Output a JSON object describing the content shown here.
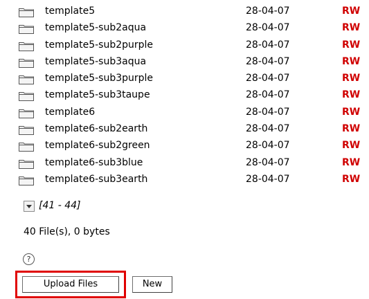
{
  "files": [
    {
      "name": "template5",
      "date": "28-04-07",
      "perm": "RW"
    },
    {
      "name": "template5-sub2aqua",
      "date": "28-04-07",
      "perm": "RW"
    },
    {
      "name": "template5-sub2purple",
      "date": "28-04-07",
      "perm": "RW"
    },
    {
      "name": "template5-sub3aqua",
      "date": "28-04-07",
      "perm": "RW"
    },
    {
      "name": "template5-sub3purple",
      "date": "28-04-07",
      "perm": "RW"
    },
    {
      "name": "template5-sub3taupe",
      "date": "28-04-07",
      "perm": "RW"
    },
    {
      "name": "template6",
      "date": "28-04-07",
      "perm": "RW"
    },
    {
      "name": "template6-sub2earth",
      "date": "28-04-07",
      "perm": "RW"
    },
    {
      "name": "template6-sub2green",
      "date": "28-04-07",
      "perm": "RW"
    },
    {
      "name": "template6-sub3blue",
      "date": "28-04-07",
      "perm": "RW"
    },
    {
      "name": "template6-sub3earth",
      "date": "28-04-07",
      "perm": "RW"
    }
  ],
  "pager": {
    "range_label": "[41 - 44]",
    "icon": "chevron-down-icon"
  },
  "summary": "40 File(s), 0 bytes",
  "help": {
    "icon": "help-icon",
    "glyph": "?"
  },
  "buttons": {
    "upload_label": "Upload Files",
    "new_label": "New"
  },
  "colors": {
    "permission": "#d00000",
    "highlight": "#e00000",
    "folder_stroke": "#555555",
    "folder_fill": "#f4f4f4"
  }
}
